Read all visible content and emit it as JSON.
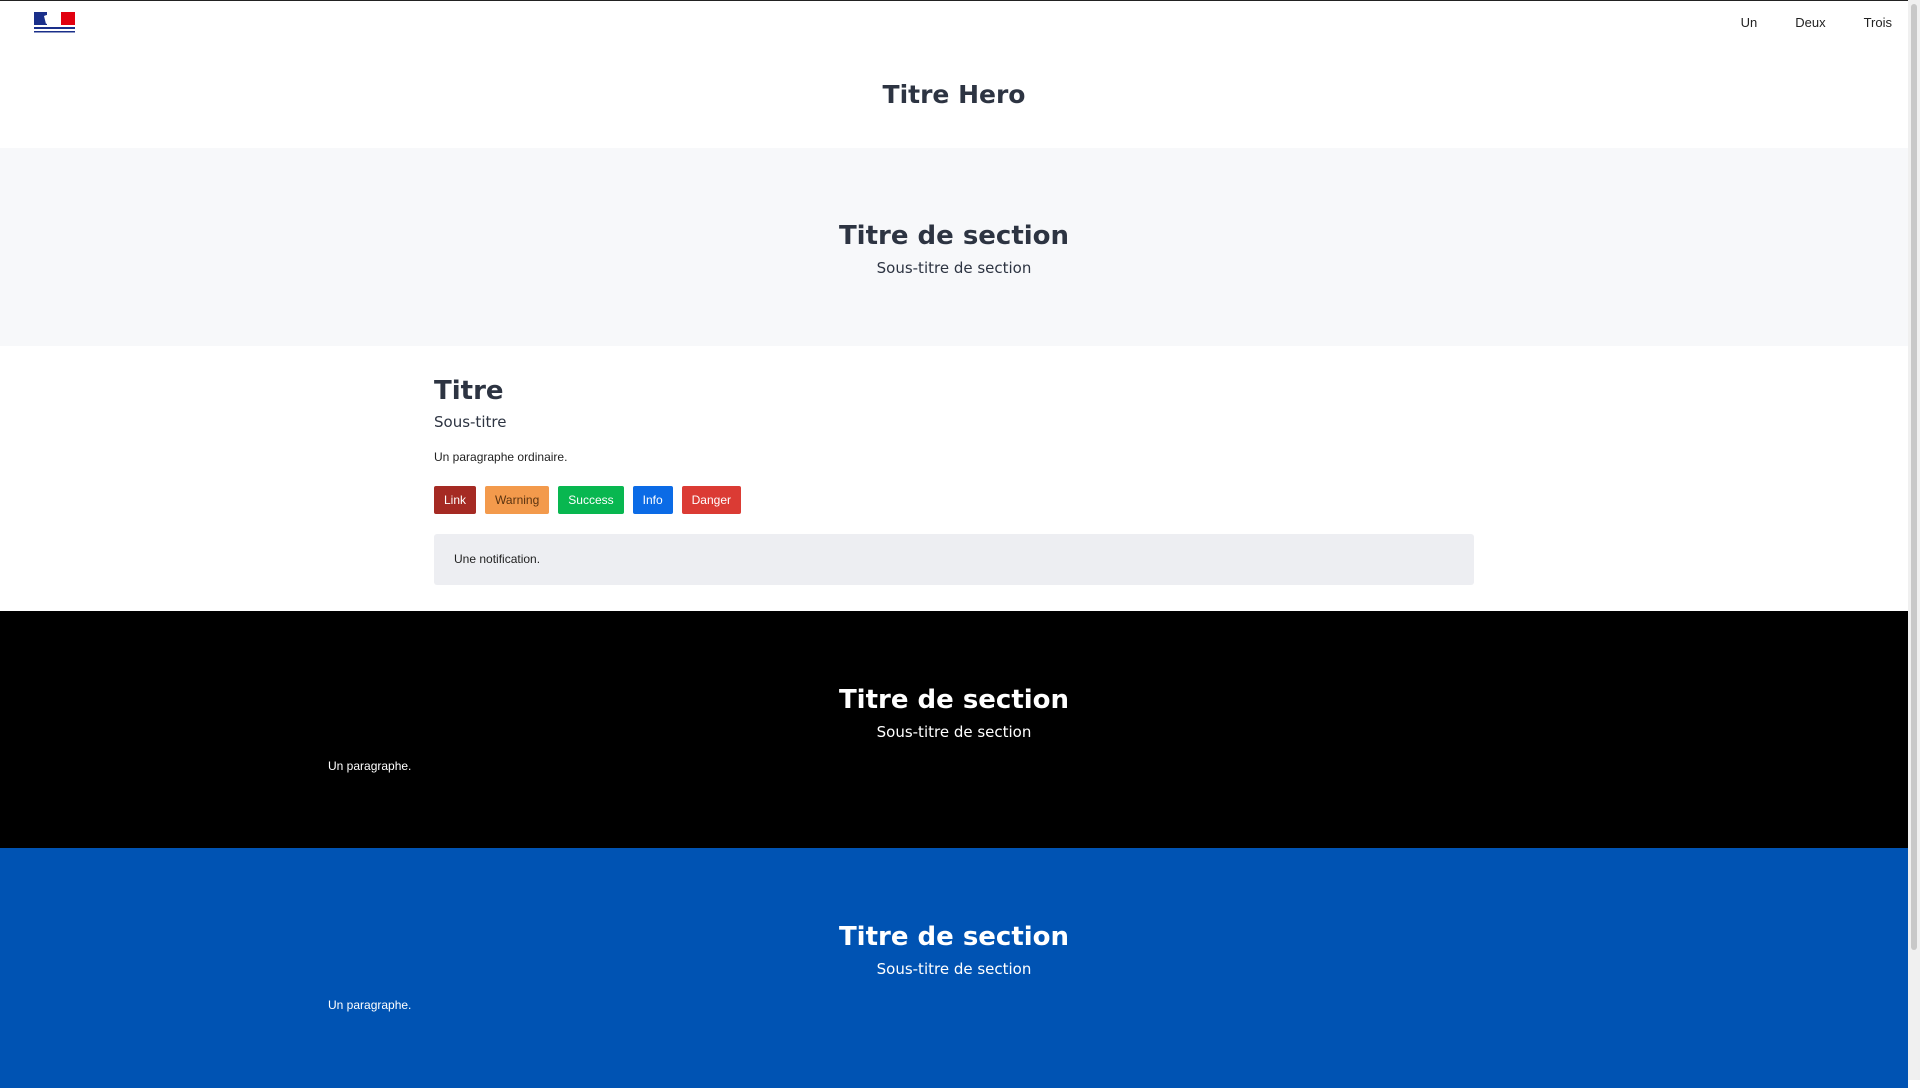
{
  "nav": {
    "logo_alt": "République Française",
    "links": [
      "Un",
      "Deux",
      "Trois"
    ]
  },
  "hero": {
    "title": "Titre Hero"
  },
  "section_grey": {
    "title": "Titre de section",
    "subtitle": "Sous-titre de section"
  },
  "content": {
    "title": "Titre",
    "subtitle": "Sous-titre",
    "paragraph": "Un paragraphe ordinaire.",
    "buttons": [
      "Link",
      "Warning",
      "Success",
      "Info",
      "Danger"
    ],
    "notification": "Une notification."
  },
  "section_dark": {
    "title": "Titre de section",
    "subtitle": "Sous-titre de section",
    "paragraph": "Un paragraphe."
  },
  "section_blue": {
    "title": "Titre de section",
    "subtitle": "Sous-titre de section",
    "paragraph": "Un paragraphe."
  },
  "colors": {
    "link": "#a52a23",
    "warning": "#f39a4c",
    "success": "#08b750",
    "info": "#0b6be6",
    "danger": "#db3b34",
    "dark_bg": "#000000",
    "blue_bg": "#0053b3",
    "grey_bg": "#f7f8fa"
  }
}
